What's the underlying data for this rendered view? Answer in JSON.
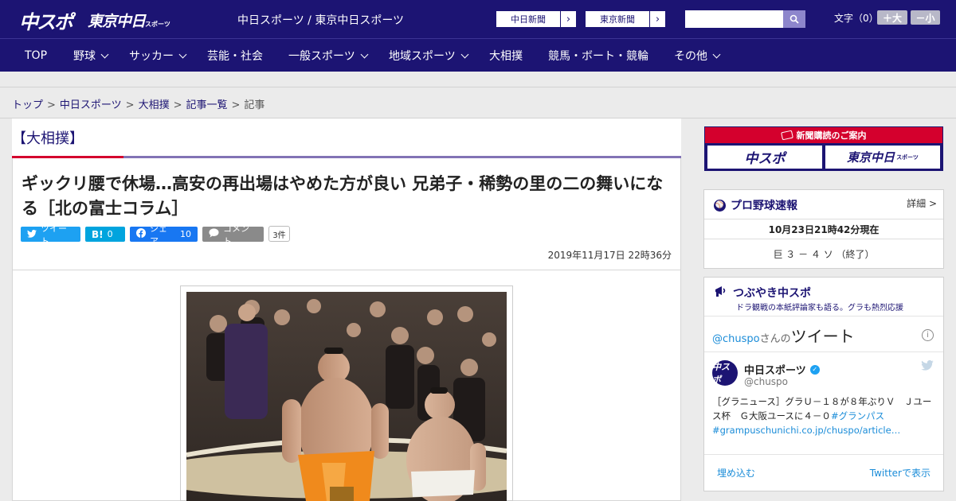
{
  "header": {
    "logo_chuspo": "中スポ",
    "logo_tokyo": "東京中日",
    "logo_tokyo_small": "スポーツ",
    "site_names": "中日スポーツ / 東京中日スポーツ",
    "ext_links": [
      {
        "label": "中日新聞"
      },
      {
        "label": "東京新聞"
      }
    ],
    "font_label": "文字（0）",
    "font_bigger": "＋大",
    "font_smaller": "－小"
  },
  "nav": [
    {
      "label": "TOP",
      "dropdown": false
    },
    {
      "label": "野球",
      "dropdown": true
    },
    {
      "label": "サッカー",
      "dropdown": true
    },
    {
      "label": "芸能・社会",
      "dropdown": false
    },
    {
      "label": "一般スポーツ",
      "dropdown": true
    },
    {
      "label": "地域スポーツ",
      "dropdown": true
    },
    {
      "label": "大相撲",
      "dropdown": false
    },
    {
      "label": "競馬・ボート・競輪",
      "dropdown": false
    },
    {
      "label": "その他",
      "dropdown": true
    }
  ],
  "breadcrumb": {
    "items": [
      "トップ",
      "中日スポーツ",
      "大相撲",
      "記事一覧"
    ],
    "current": "記事",
    "separator": ">"
  },
  "article": {
    "category": "【大相撲】",
    "headline": "ギックリ腰で休場…高安の再出場はやめた方が良い 兄弟子・稀勢の里の二の舞いになる［北の富士コラム］",
    "share": {
      "tweet": "ツイート",
      "hatena_icon": "B!",
      "hatena_count": "0",
      "facebook": "シェア",
      "facebook_count": "10",
      "comment": "コメント",
      "comment_count": "3件"
    },
    "date": "2019年11月17日 22時36分"
  },
  "sidebar": {
    "subscription": {
      "title": "新聞購読のご案内",
      "chuspo": "中スポ",
      "tokyo": "東京中日",
      "tokyo_small": "スポーツ"
    },
    "baseball": {
      "title": "プロ野球速報",
      "detail": "詳細 >",
      "date": "10月23日21時42分現在",
      "score": "巨 ３ － ４ ソ （終了）"
    },
    "twitter": {
      "title": "つぶやき中スポ",
      "subtitle": "ドラ観戦の本紙評論家も語る。グラも熱烈応援",
      "by_handle": "@chuspo",
      "by_san": "さんの",
      "by_tweet": "ツイート",
      "info": "i",
      "avatar": "中スポ",
      "name": "中日スポーツ",
      "verified": "✓",
      "handle": "@chuspo",
      "text": "［グラニュース］グラＵ－１８が８年ぶりＶ　Ｊユース杯　Ｇ大阪ユースに４－０",
      "text_link": "#グランパス",
      "text_url": "#grampuschunichi.co.jp/chuspo/article…",
      "embed": "埋め込む",
      "view_on": "Twitterで表示"
    }
  },
  "colors": {
    "brand_navy": "#1c1473",
    "accent_red": "#d4002d",
    "twitter_blue": "#1da1f2",
    "hatena_blue": "#00a4de",
    "facebook_blue": "#1877f2"
  }
}
